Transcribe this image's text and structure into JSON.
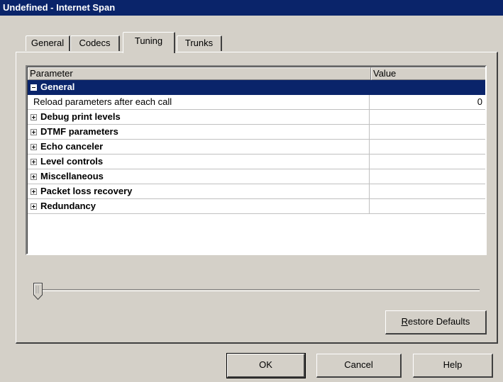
{
  "window": {
    "title": "Undefined - Internet Span"
  },
  "tabs": [
    {
      "label": "General",
      "active": false
    },
    {
      "label": "Codecs",
      "active": false
    },
    {
      "label": "Tuning",
      "active": true
    },
    {
      "label": "Trunks",
      "active": false
    }
  ],
  "grid": {
    "columns": {
      "parameter": "Parameter",
      "value": "Value"
    },
    "rows": [
      {
        "label": "General",
        "value": "",
        "group": true,
        "expanded": true,
        "selected": true
      },
      {
        "label": "Reload parameters after each call",
        "value": "0",
        "group": false
      },
      {
        "label": "Debug print levels",
        "value": "",
        "group": true,
        "expanded": false
      },
      {
        "label": "DTMF parameters",
        "value": "",
        "group": true,
        "expanded": false
      },
      {
        "label": "Echo canceler",
        "value": "",
        "group": true,
        "expanded": false
      },
      {
        "label": "Level controls",
        "value": "",
        "group": true,
        "expanded": false
      },
      {
        "label": "Miscellaneous",
        "value": "",
        "group": true,
        "expanded": false
      },
      {
        "label": "Packet loss recovery",
        "value": "",
        "group": true,
        "expanded": false
      },
      {
        "label": "Redundancy",
        "value": "",
        "group": true,
        "expanded": false
      }
    ]
  },
  "slider": {
    "level": 0
  },
  "buttons": {
    "restore_defaults": {
      "underlined": "R",
      "rest": "estore Defaults"
    },
    "ok": "OK",
    "cancel": "Cancel",
    "help": "Help"
  },
  "colors": {
    "selection": "#0a246a",
    "face": "#d4d0c8"
  }
}
